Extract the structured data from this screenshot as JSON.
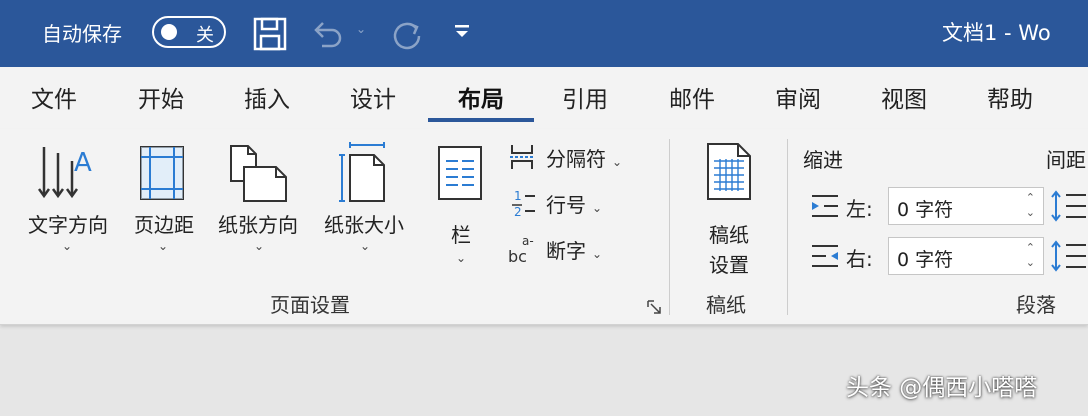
{
  "titlebar": {
    "autosave_label": "自动保存",
    "autosave_state": "关",
    "document_title": "文档1 - Wo"
  },
  "tabs": [
    {
      "label": "文件"
    },
    {
      "label": "开始"
    },
    {
      "label": "插入"
    },
    {
      "label": "设计"
    },
    {
      "label": "布局",
      "active": true
    },
    {
      "label": "引用"
    },
    {
      "label": "邮件"
    },
    {
      "label": "审阅"
    },
    {
      "label": "视图"
    },
    {
      "label": "帮助"
    }
  ],
  "ribbon": {
    "page_setup": {
      "text_direction": "文字方向",
      "margins": "页边距",
      "orientation": "纸张方向",
      "size": "纸张大小",
      "columns": "栏",
      "breaks": "分隔符",
      "line_numbers": "行号",
      "hyphenation": "断字",
      "group_label": "页面设置"
    },
    "manuscript": {
      "button_label_line1": "稿纸",
      "button_label_line2": "设置",
      "group_label": "稿纸"
    },
    "paragraph": {
      "indent_header": "缩进",
      "spacing_header": "间距",
      "left_label": "左:",
      "left_value": "0 字符",
      "right_label": "右:",
      "right_value": "0 字符",
      "group_label": "段落"
    }
  },
  "watermark": "头条 @偶西小嗒嗒",
  "colors": {
    "title_bar": "#2b579a",
    "ribbon_bg": "#f3f3f3",
    "icon_blue": "#2b7cd3"
  }
}
